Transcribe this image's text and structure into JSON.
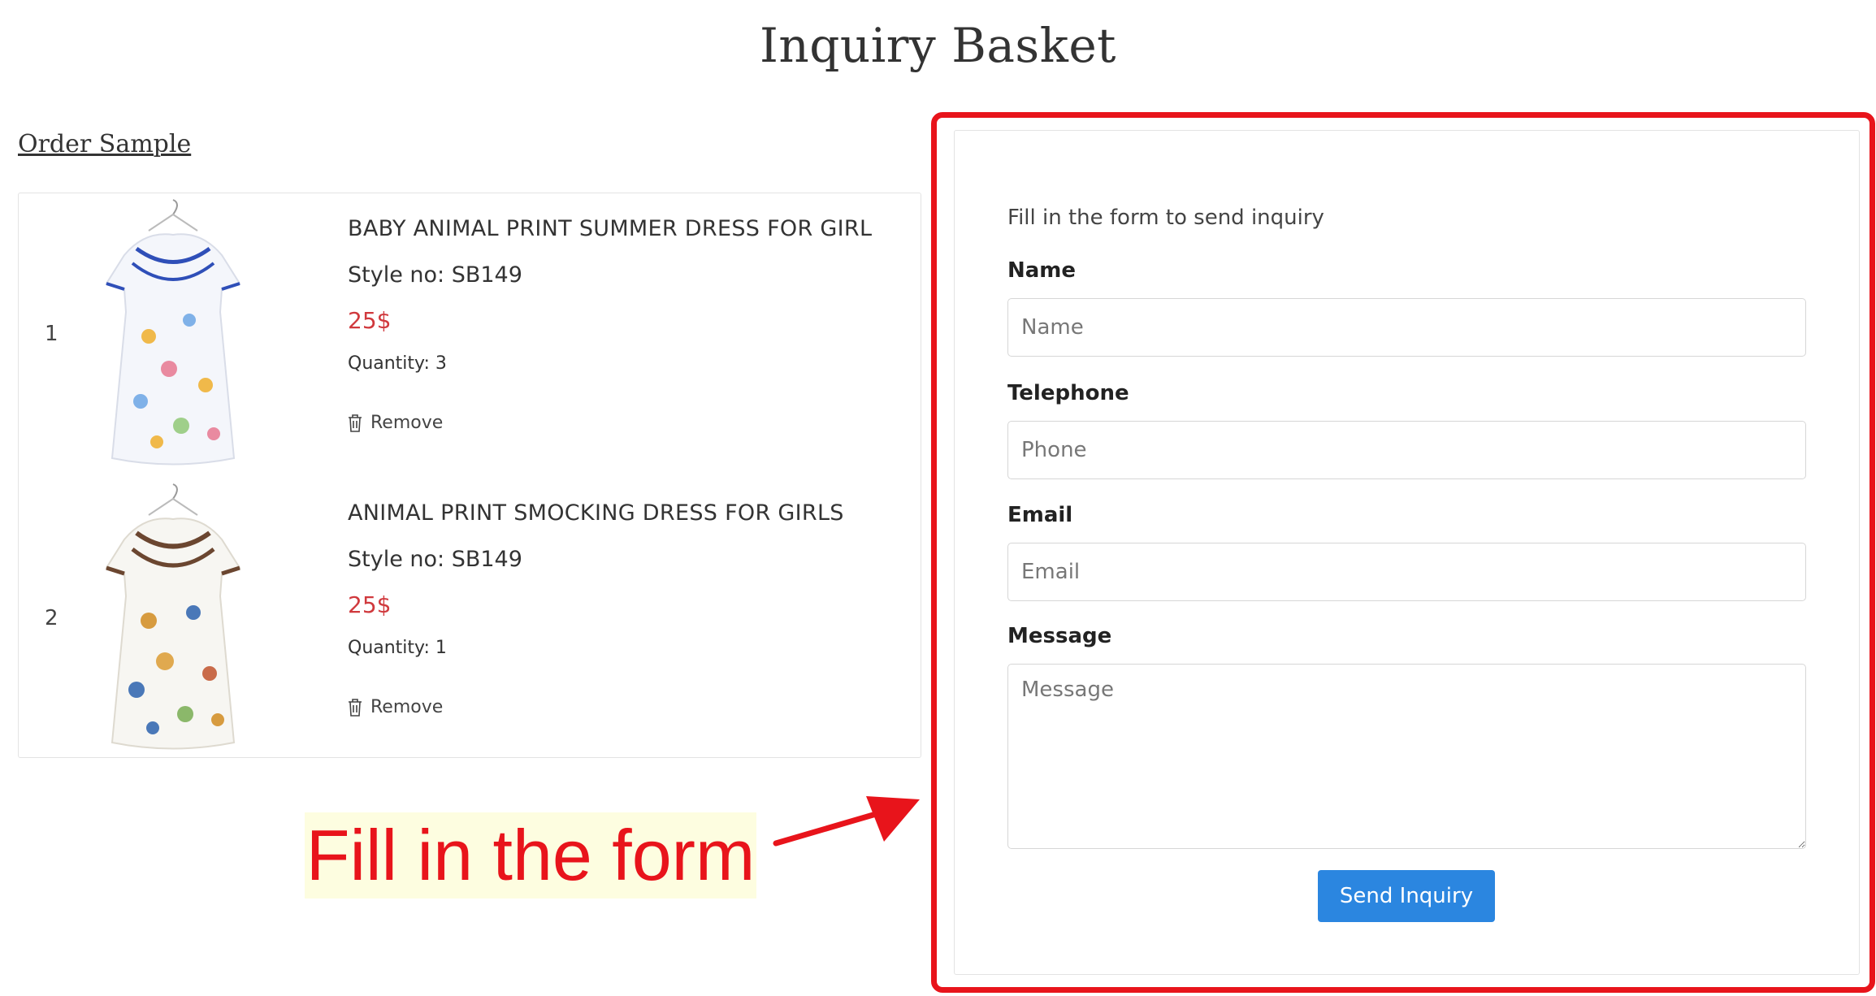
{
  "page": {
    "title": "Inquiry Basket"
  },
  "basket": {
    "section_title": "Order Sample",
    "items": [
      {
        "index": "1",
        "name": "BABY ANIMAL PRINT SUMMER DRESS FOR GIRL",
        "style": "Style no: SB149",
        "price": "25$",
        "quantity": "Quantity: 3",
        "remove_label": "Remove",
        "trim_color": "#2f4fb8"
      },
      {
        "index": "2",
        "name": "ANIMAL PRINT SMOCKING DRESS FOR GIRLS",
        "style": "Style no: SB149",
        "price": "25$",
        "quantity": "Quantity: 1",
        "remove_label": "Remove",
        "trim_color": "#6b4630"
      }
    ]
  },
  "form": {
    "intro": "Fill in the form to send inquiry",
    "name_label": "Name",
    "name_placeholder": "Name",
    "phone_label": "Telephone",
    "phone_placeholder": "Phone",
    "email_label": "Email",
    "email_placeholder": "Email",
    "message_label": "Message",
    "message_placeholder": "Message",
    "submit_label": "Send Inquiry"
  },
  "annotation": {
    "text": "Fill in the form",
    "color": "#e8141b"
  },
  "colors": {
    "price": "#d0393d",
    "button": "#2b86e0"
  }
}
